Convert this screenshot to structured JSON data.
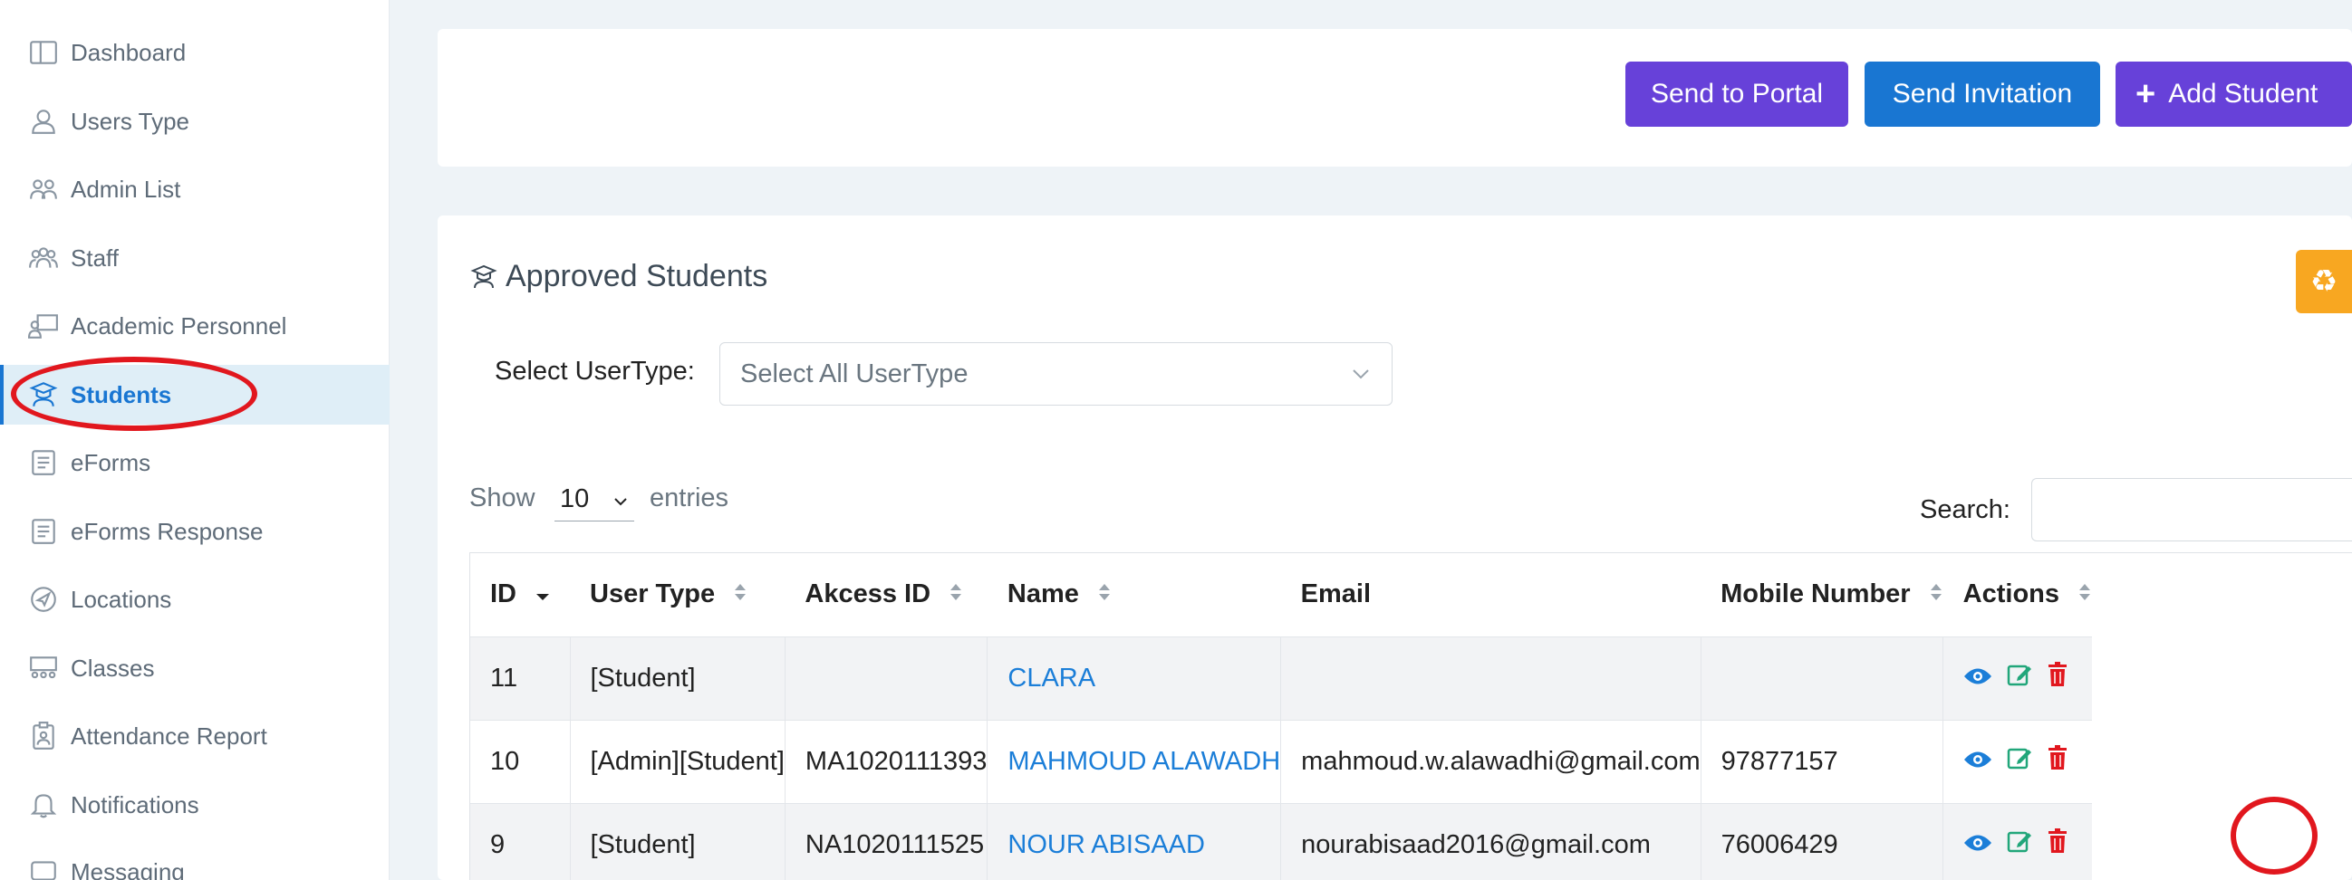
{
  "sidebar": {
    "items": [
      {
        "label": "Dashboard",
        "icon": "dashboard-icon"
      },
      {
        "label": "Users Type",
        "icon": "user-icon"
      },
      {
        "label": "Admin List",
        "icon": "admin-group-icon"
      },
      {
        "label": "Staff",
        "icon": "staff-group-icon"
      },
      {
        "label": "Academic Personnel",
        "icon": "teacher-board-icon"
      },
      {
        "label": "Students",
        "icon": "graduate-icon"
      },
      {
        "label": "eForms",
        "icon": "form-icon"
      },
      {
        "label": "eForms Response",
        "icon": "form-response-icon"
      },
      {
        "label": "Locations",
        "icon": "location-icon"
      },
      {
        "label": "Classes",
        "icon": "classes-icon"
      },
      {
        "label": "Attendance Report",
        "icon": "clipboard-icon"
      },
      {
        "label": "Notifications",
        "icon": "bell-icon"
      },
      {
        "label": "Messaging",
        "icon": "message-icon"
      }
    ],
    "active": "Students"
  },
  "toolbar": {
    "send_portal_label": "Send to Portal",
    "send_invitation_label": "Send Invitation",
    "add_student_label": "Add Student"
  },
  "panel": {
    "title": "Approved Students",
    "usertype_label": "Select UserType:",
    "usertype_value": "Select All UserType",
    "show_label": "Show",
    "entries_value": "10",
    "entries_label": "entries",
    "search_label": "Search:"
  },
  "table": {
    "columns": [
      "ID",
      "User Type",
      "Akcess ID",
      "Name",
      "Email",
      "Mobile Number",
      "Actions"
    ],
    "rows": [
      {
        "id": "11",
        "user_type": "[Student]",
        "akcess_id": "",
        "name": "CLARA",
        "email": "",
        "mobile": ""
      },
      {
        "id": "10",
        "user_type": "[Admin][Student]",
        "akcess_id": "MA1020111393",
        "name": "MAHMOUD ALAWADH",
        "email": "mahmoud.w.alawadhi@gmail.com",
        "mobile": "97877157"
      },
      {
        "id": "9",
        "user_type": "[Student]",
        "akcess_id": "NA1020111525",
        "name": "NOUR ABISAAD",
        "email": "nourabisaad2016@gmail.com",
        "mobile": "76006429"
      }
    ]
  },
  "colors": {
    "purple_button": "#6741d9",
    "blue_button": "#1976d2",
    "orange_button": "#f8a721",
    "link": "#1b7ed8",
    "annotation_red": "#e1171e"
  }
}
